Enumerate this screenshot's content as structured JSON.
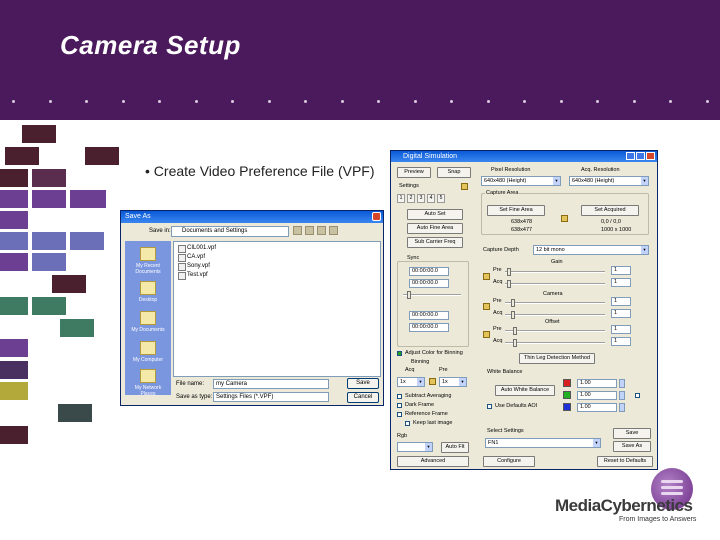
{
  "slide": {
    "title": "Camera Setup",
    "bullet": "• Create Video Preference File (VPF)",
    "colors": {
      "header": "#4b1a5c",
      "tile_dark": "#4a1f2e",
      "tile_purple": "#6d3f92",
      "tile_blue": "#6b6fb8",
      "tile_green": "#3f7a63",
      "tile_olive": "#b2a93a"
    }
  },
  "saveas": {
    "title": "Save As",
    "save_in_label": "Save in:",
    "save_in_value": "Documents and Settings",
    "places": [
      "My Recent Documents",
      "Desktop",
      "My Documents",
      "My Computer",
      "My Network Places"
    ],
    "files": [
      "CIL001.vpf",
      "CA.vpf",
      "Sony.vpf",
      "Test.vpf"
    ],
    "file_name_label": "File name:",
    "file_name_value": "my Camera",
    "save_type_label": "Save as type:",
    "save_type_value": "Settings Files (*.VPF)",
    "save_button": "Save",
    "cancel_button": "Cancel"
  },
  "dsim": {
    "title": "Digital Simulation",
    "preview_button": "Preview",
    "snap_button": "Snap",
    "settings_label": "Settings",
    "tabs": [
      "1",
      "2",
      "3",
      "4",
      "5"
    ],
    "auto_set_button": "Auto Set",
    "auto_fine_button": "Auto Fine Area",
    "sub_carrier_button": "Sub Carrier Freq",
    "pixel_resolution_label": "Pixel Resolution",
    "acq_resolution_label": "Acq. Resolution",
    "pixel_resolution_value": "640x480 (Height)",
    "acq_resolution_value": "640x480 (Height)",
    "capture_area_label": "Capture Area",
    "set_fine_area_button": "Set Fine Area",
    "set_acquired_button": "Set Acquired",
    "capture_area_values": [
      "638x478",
      "638x477"
    ],
    "capture_coords": [
      "0,0 / 0,0",
      "1000 x 1000"
    ],
    "sync_label": "Sync",
    "sync_value": "00:00:00.0",
    "sync_value2": "00:00:00.0",
    "capture_depth_label": "Capture Depth",
    "capture_depth_value": "12 bit mono",
    "gain_label": "Gain",
    "pre_label": "Pre",
    "acq_label": "Acq",
    "camera_label": "Camera",
    "offset_label": "Offset",
    "gain_values": [
      "1",
      "1"
    ],
    "camera_values": [
      "1",
      "1"
    ],
    "offset_values": [
      "1",
      "1"
    ],
    "rescan_button": "Thin Leg Detection Method",
    "adjust_check": "Adjust Color for Binning",
    "binning_label": "Binning",
    "binning_x": "1x",
    "binning_y": "1x",
    "white_balance_label": "White Balance",
    "auto_white_button": "Auto White Balance",
    "white_values": [
      "1.00",
      "1.00",
      "1.00"
    ],
    "check_subtract": "Subtract Averaging",
    "check_dark": "Dark Frame",
    "check_reference": "Reference Frame",
    "check_keep": "Keep last image",
    "use_defaults": "Use Defaults AOI",
    "select_settings_label": "Select Settings",
    "select_settings_value": "FN1",
    "rgb_label": "Rgb",
    "filter_label": "Auto Flt",
    "save_button": "Save",
    "save_as_button": "Save As",
    "advanced_button": "Advanced",
    "configure_button": "Configure",
    "reset_button": "Reset to Defaults"
  },
  "logo": {
    "name": "MediaCybernetics",
    "tagline": "From Images to Answers"
  }
}
